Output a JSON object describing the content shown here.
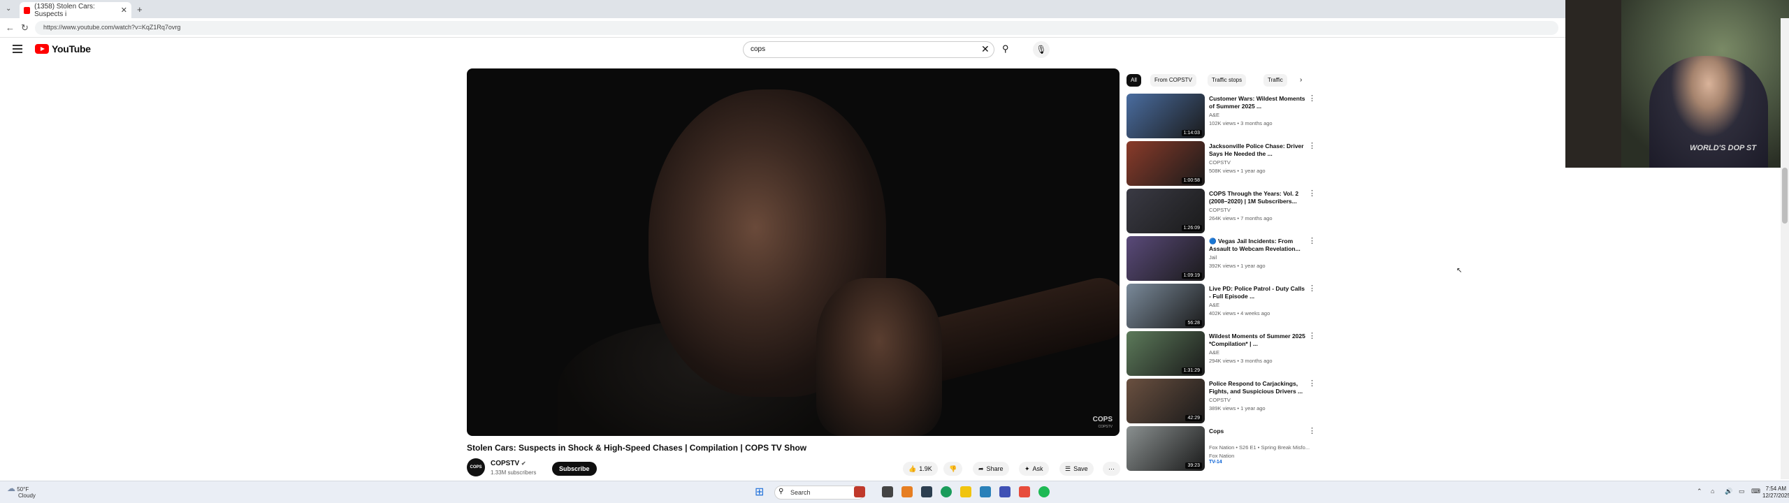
{
  "browser": {
    "tab_title": "(1358) Stolen Cars: Suspects i",
    "url": "https://www.youtube.com/watch?v=KqZ1Rq7ovrg"
  },
  "header": {
    "logo_text": "YouTube",
    "search_value": "cops"
  },
  "player": {
    "watermark": "COPS",
    "watermark_sub": "COPSTV"
  },
  "video": {
    "title": "Stolen Cars: Suspects in Shock & High-Speed Chases | Compilation | COPS TV Show",
    "channel": "COPSTV",
    "subscribers": "1.33M subscribers",
    "subscribe_label": "Subscribe",
    "likes": "1.9K",
    "share_label": "Share",
    "ask_label": "Ask",
    "save_label": "Save",
    "channel_avatar": "COPS"
  },
  "chips": [
    "All",
    "From COPSTV",
    "Traffic stops",
    "Traffic"
  ],
  "recommendations": [
    {
      "title": "Customer Wars: Wildest Moments of Summer 2025 ...",
      "channel": "A&E",
      "meta": "102K views • 3 months ago",
      "duration": "1:14:03",
      "color": "#4a6da0"
    },
    {
      "title": "Jacksonville Police Chase: Driver Says He Needed the ...",
      "channel": "COPSTV",
      "meta": "508K views • 1 year ago",
      "duration": "1:00:58",
      "color": "#8a3b2a"
    },
    {
      "title": "COPS Through the Years: Vol. 2 (2008–2020) | 1M Subscribers...",
      "channel": "COPSTV",
      "meta": "264K views • 7 months ago",
      "duration": "1:26:09",
      "color": "#3a3a44"
    },
    {
      "title": "🔵 Vegas Jail Incidents: From Assault to Webcam Revelation...",
      "channel": "Jail",
      "meta": "392K views • 1 year ago",
      "duration": "1:09:19",
      "color": "#5a4a7a"
    },
    {
      "title": "Live PD: Police Patrol - Duty Calls - Full Episode ...",
      "channel": "A&E",
      "meta": "402K views • 4 weeks ago",
      "duration": "56:28",
      "color": "#7a8a9a"
    },
    {
      "title": "Wildest Moments of Summer 2025 *Compilation* | ...",
      "channel": "A&E",
      "meta": "294K views • 3 months ago",
      "duration": "1:31:29",
      "color": "#5c7a5a"
    },
    {
      "title": "Police Respond to Carjackings, Fights, and Suspicious Drivers ...",
      "channel": "COPSTV",
      "meta": "389K views • 1 year ago",
      "duration": "42:29",
      "color": "#6a5040"
    },
    {
      "title": "Cops",
      "channel": "Fox Nation • S26 E1 • Spring Break Misfo...",
      "meta": "Fox Nation",
      "tag": "TV-14",
      "duration": "39:23",
      "color": "#8a9090"
    }
  ],
  "webcam": {
    "shirt_text": "WORLD'S DOP ST"
  },
  "taskbar": {
    "weather_temp": "50°F",
    "weather_desc": "Cloudy",
    "search_placeholder": "Search",
    "time": "7:54 AM",
    "date": "12/27/2025"
  }
}
